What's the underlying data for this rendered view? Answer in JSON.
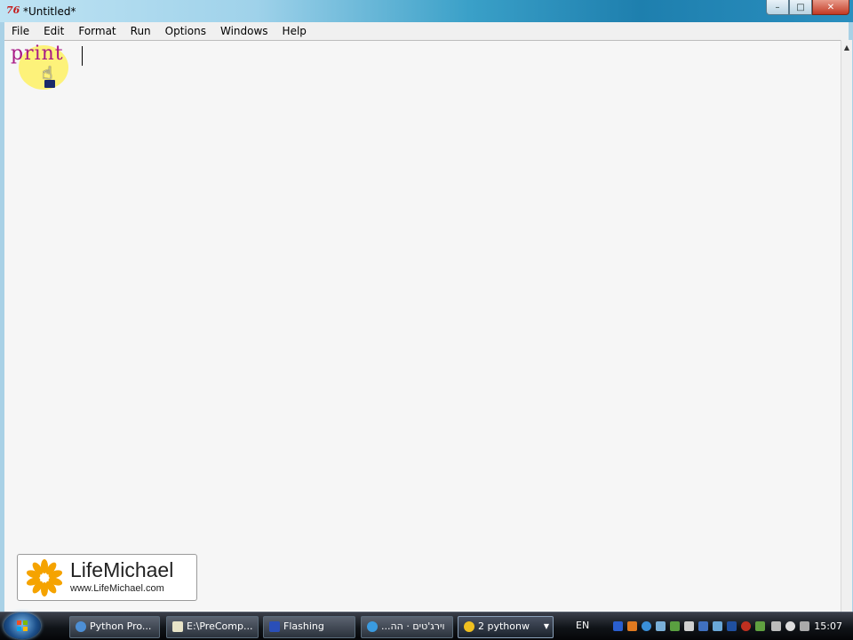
{
  "window": {
    "title": "*Untitled*",
    "app_icon": "76"
  },
  "menu": [
    "File",
    "Edit",
    "Format",
    "Run",
    "Options",
    "Windows",
    "Help"
  ],
  "editor": {
    "code": "print"
  },
  "logo": {
    "title": "LifeMichael",
    "url": "www.LifeMichael.com"
  },
  "taskbar": {
    "tasks": [
      {
        "label": "Python Pro...",
        "icon": "python-icon"
      },
      {
        "label": "E:\\PreComp...",
        "icon": "notepad-icon"
      },
      {
        "label": "Flashing",
        "icon": "flashing-icon"
      },
      {
        "label": "...וירג'טים · הה",
        "icon": "ie-icon"
      },
      {
        "label": "2 pythonw",
        "icon": "python-icon"
      }
    ],
    "lang": "EN",
    "clock": "15:07"
  }
}
